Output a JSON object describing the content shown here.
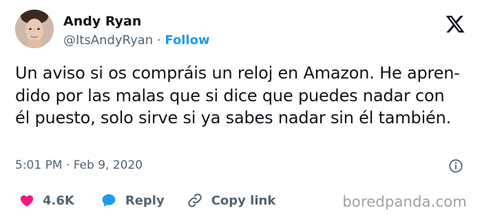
{
  "author": {
    "name": "Andy Ryan",
    "handle": "@ItsAndyRyan",
    "separator": "·",
    "follow_label": "Follow"
  },
  "tweet": {
    "lines": [
      "Un aviso si os compráis un reloj en Amazon. He apren-",
      "dido por las malas que si dice que puedes nadar con",
      "él puesto, solo sirve si ya sabes nadar sin él también."
    ],
    "timestamp": "5:01 PM · Feb 9, 2020"
  },
  "actions": {
    "like_count": "4.6K",
    "reply_label": "Reply",
    "copy_link_label": "Copy link"
  },
  "watermark": "boredpanda.com",
  "colors": {
    "like": "#f91880",
    "reply": "#1d9bf0",
    "link": "#1d9bf0",
    "secondary_text": "#536471"
  }
}
